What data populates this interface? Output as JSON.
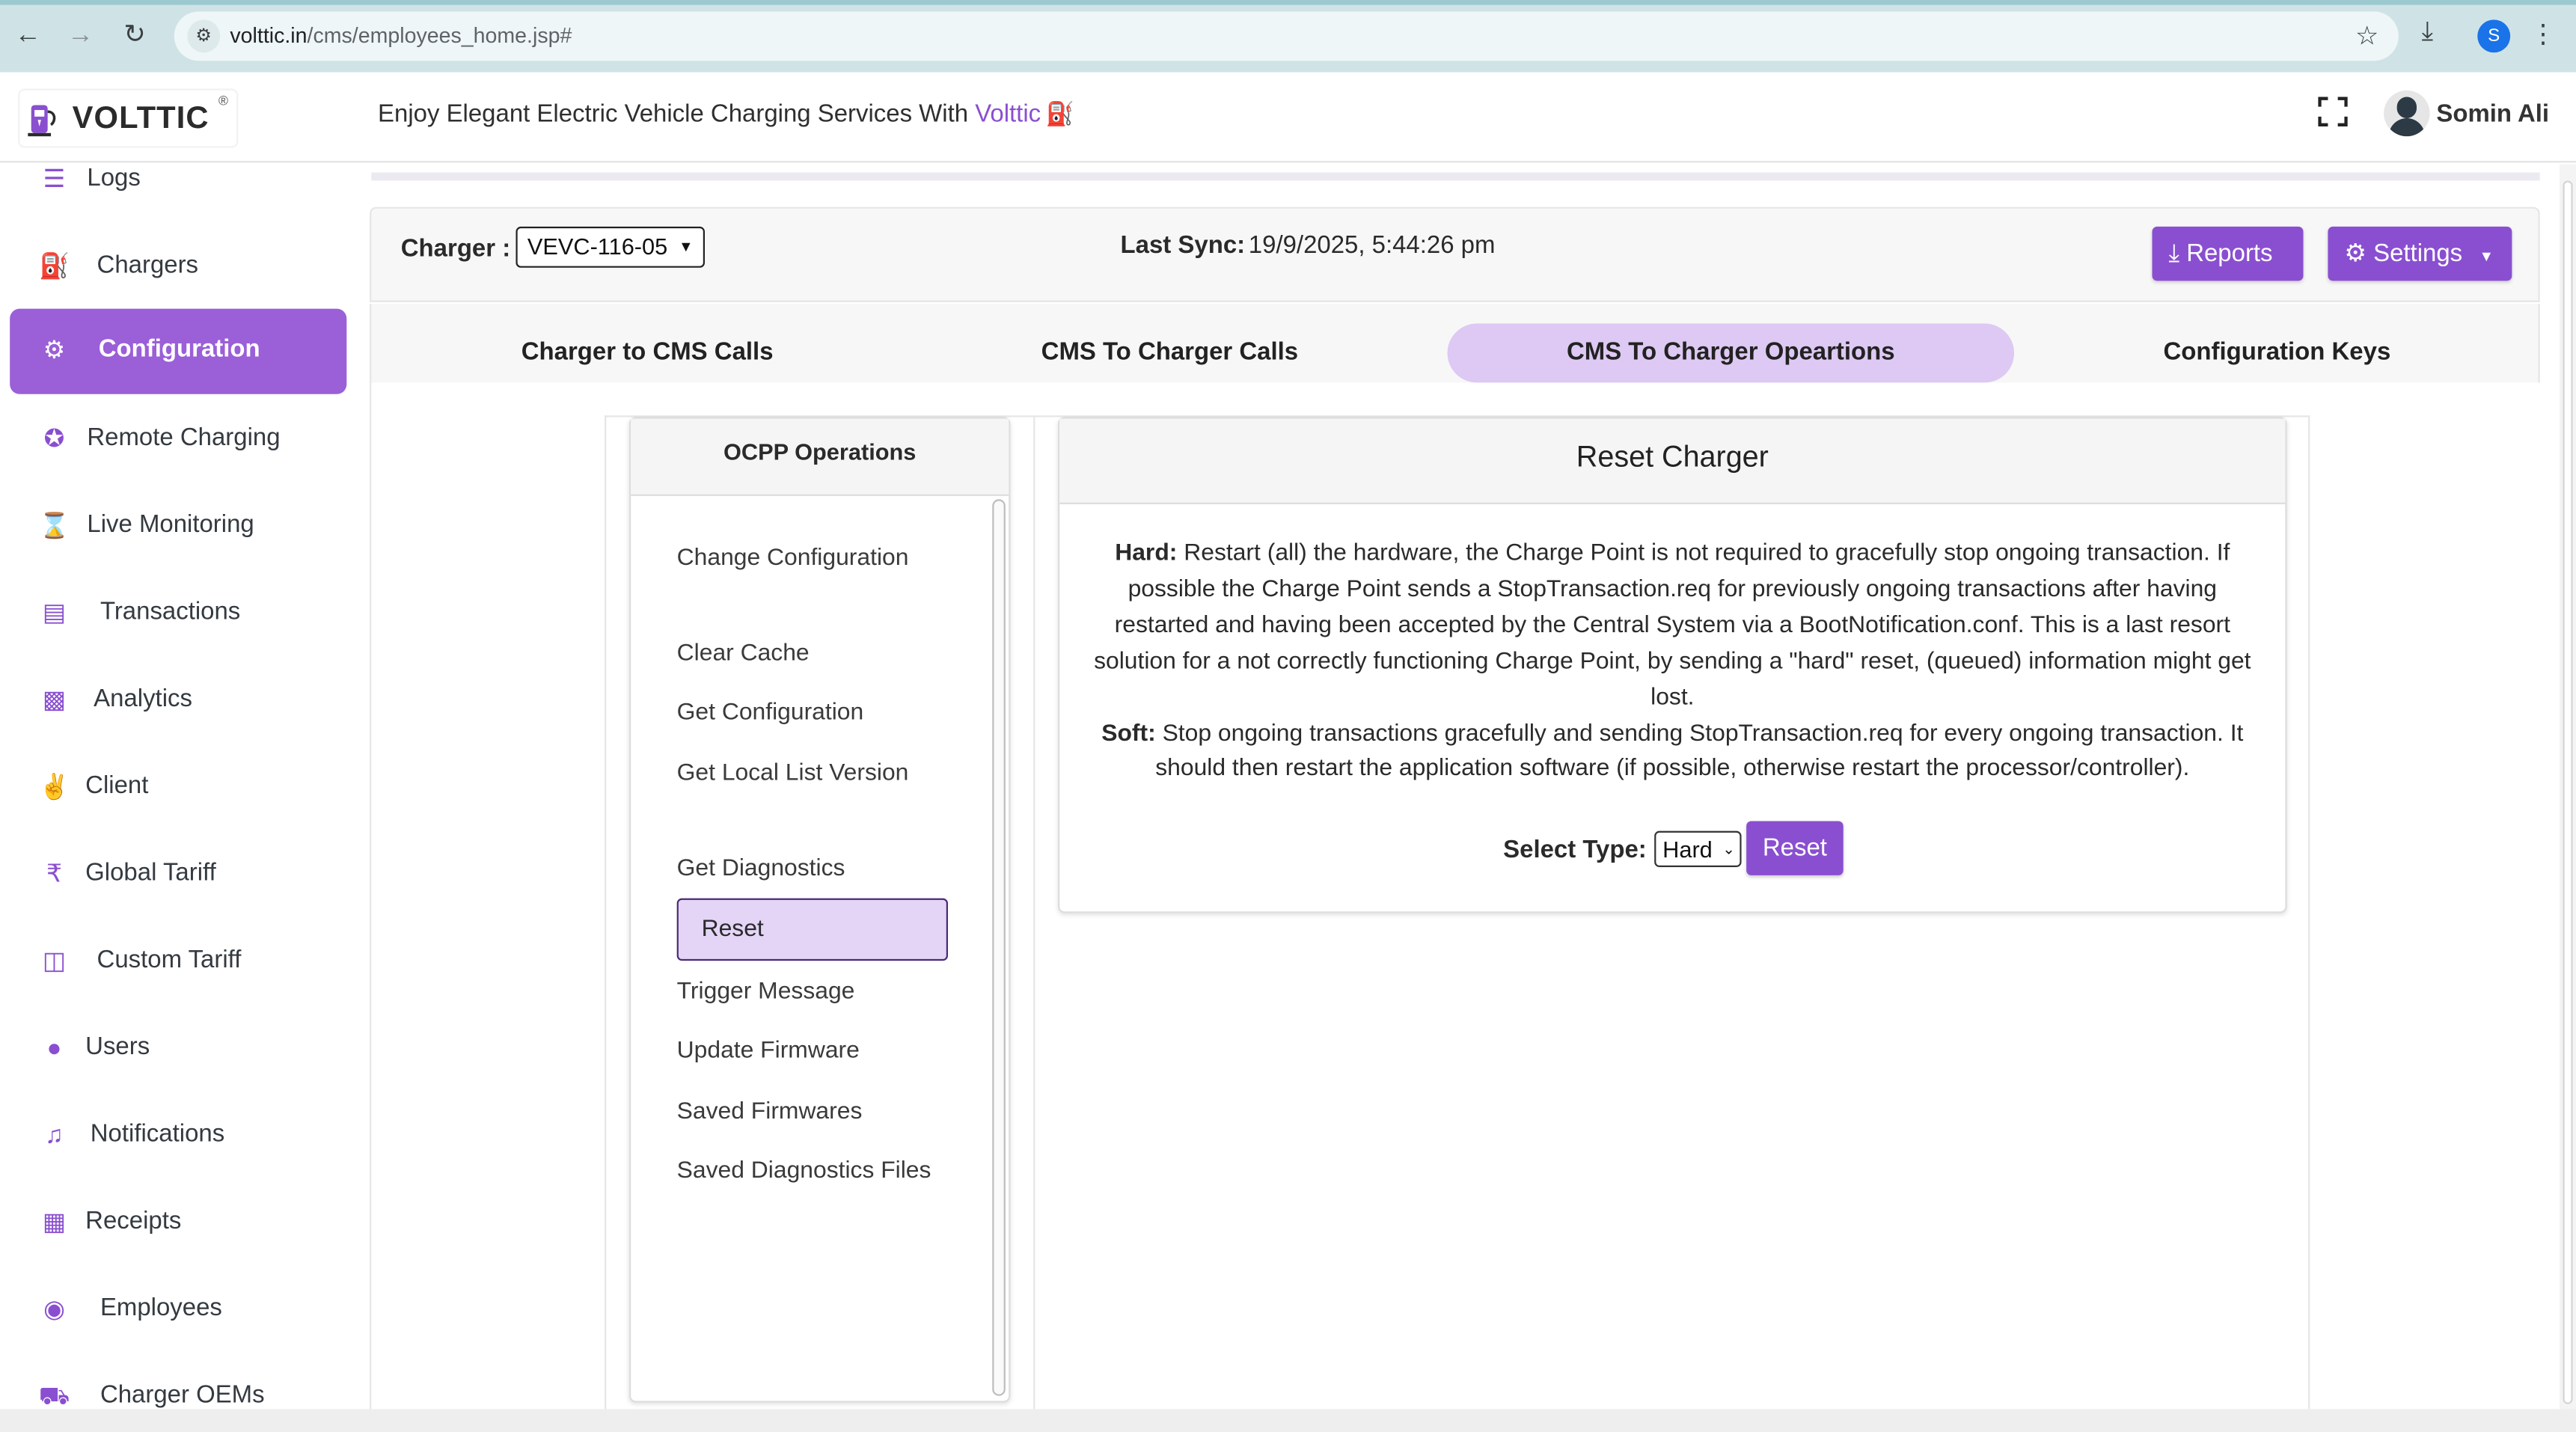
{
  "browser": {
    "url_host": "volttic.in",
    "url_path": "/cms/employees_home.jsp#",
    "profile_initial": "S"
  },
  "header": {
    "logo_text": "VOLTTIC",
    "logo_reg": "®",
    "tagline_prefix": "Enjoy Elegant Electric Vehicle Charging Services With",
    "tagline_brand": "Volttic",
    "user_name": "Somin Ali"
  },
  "sidebar": {
    "items": [
      {
        "label": "Logs",
        "icon": "logs-icon"
      },
      {
        "label": "Chargers",
        "icon": "charger-icon"
      },
      {
        "label": "Configuration",
        "icon": "gears-icon",
        "active": true
      },
      {
        "label": "Remote Charging",
        "icon": "plug-icon"
      },
      {
        "label": "Live Monitoring",
        "icon": "hourglass-icon"
      },
      {
        "label": "Transactions",
        "icon": "card-icon"
      },
      {
        "label": "Analytics",
        "icon": "bar-chart-icon"
      },
      {
        "label": "Client",
        "icon": "handshake-icon"
      },
      {
        "label": "Global Tariff",
        "icon": "rupee-icon"
      },
      {
        "label": "Custom Tariff",
        "icon": "custom-tariff-icon"
      },
      {
        "label": "Users",
        "icon": "users-icon"
      },
      {
        "label": "Notifications",
        "icon": "bell-icon"
      },
      {
        "label": "Receipts",
        "icon": "receipt-icon"
      },
      {
        "label": "Employees",
        "icon": "employees-icon"
      },
      {
        "label": "Charger OEMs",
        "icon": "truck-icon"
      }
    ]
  },
  "charger_bar": {
    "charger_label": "Charger :",
    "charger_value": "VEVC-116-05",
    "last_sync_label": "Last Sync:",
    "last_sync_value": "19/9/2025, 5:44:26 pm",
    "reports_label": "Reports",
    "settings_label": "Settings"
  },
  "tabs": [
    {
      "label": "Charger to CMS Calls"
    },
    {
      "label": "CMS To Charger Calls"
    },
    {
      "label": "CMS To Charger Opeartions",
      "active": true
    },
    {
      "label": "Configuration Keys"
    }
  ],
  "ocpp": {
    "title": "OCPP Operations",
    "items": [
      "Change Configuration",
      "Clear Cache",
      "Get Configuration",
      "Get Local List Version",
      "Get Diagnostics",
      "Reset",
      "Trigger Message",
      "Update Firmware",
      "Saved Firmwares",
      "Saved Diagnostics Files"
    ],
    "active_item": "Reset"
  },
  "reset_panel": {
    "title": "Reset Charger",
    "hard_label": "Hard:",
    "hard_text": "Restart (all) the hardware, the Charge Point is not required to gracefully stop ongoing transaction. If possible the Charge Point sends a StopTransaction.req for previously ongoing transactions after having restarted and having been accepted by the Central System via a BootNotification.conf. This is a last resort solution for a not correctly functioning Charge Point, by sending a \"hard\" reset, (queued) information might get lost.",
    "soft_label": "Soft:",
    "soft_text": "Stop ongoing transactions gracefully and sending StopTransaction.req for every ongoing transaction. It should then restart the application software (if possible, otherwise restart the processor/controller).",
    "select_label": "Select Type:",
    "select_value": "Hard",
    "reset_button": "Reset"
  },
  "colors": {
    "accent": "#8a4fd0",
    "sidebar_active": "#9b5fd8",
    "tab_active": "#ddc9f3",
    "ops_active": "#e4d5f7"
  }
}
